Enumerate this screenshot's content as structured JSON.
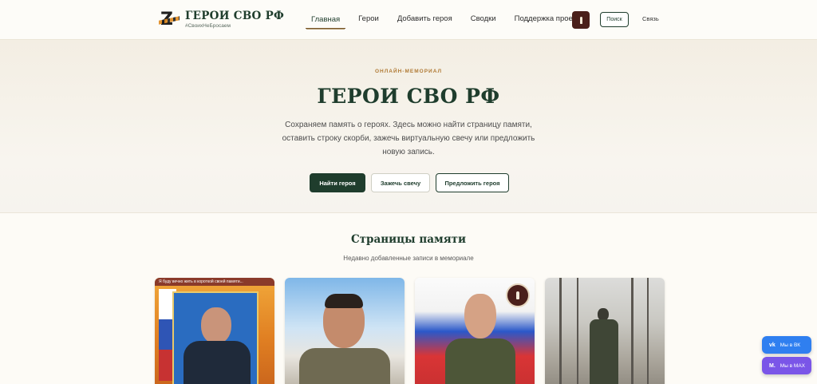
{
  "header": {
    "logo_title": "ГЕРОИ СВО РФ",
    "logo_subtitle": "#СвоихНеБросаем",
    "nav": [
      {
        "label": "Главная",
        "active": true
      },
      {
        "label": "Герои",
        "active": false
      },
      {
        "label": "Добавить героя",
        "active": false
      },
      {
        "label": "Сводки",
        "active": false
      },
      {
        "label": "Поддержка проекта",
        "active": false
      }
    ],
    "search_label": "Поиск",
    "contact_label": "Связь"
  },
  "hero": {
    "kicker": "ОНЛАЙН-МЕМОРИАЛ",
    "title": "ГЕРОИ СВО РФ",
    "description": "Сохраняем память о героях. Здесь можно найти страницу памяти, оставить строку скорби, зажечь виртуальную свечу или предложить новую запись.",
    "buttons": {
      "find": "Найти героя",
      "candle": "Зажечь свечу",
      "suggest": "Предложить героя"
    }
  },
  "memorial": {
    "title": "Страницы памяти",
    "subtitle": "Недавно добавленные записи в мемориале",
    "cards": [
      {
        "banner": "Я буду вечно жить в короткой своей памяти..."
      },
      {
        "banner": ""
      },
      {
        "banner": "",
        "candle_lit": true
      },
      {
        "banner": ""
      }
    ]
  },
  "socials": {
    "vk_icon": "vk",
    "vk_label": "Мы в ВК",
    "max_icon": "M.",
    "max_label": "Мы в MAX"
  },
  "colors": {
    "brand_green": "#1f3d2d",
    "candle_brown": "#4a1f1b",
    "kicker_gold": "#b07a35",
    "vk_blue": "#2f7ff0",
    "max_purple": "#7a55e8"
  }
}
